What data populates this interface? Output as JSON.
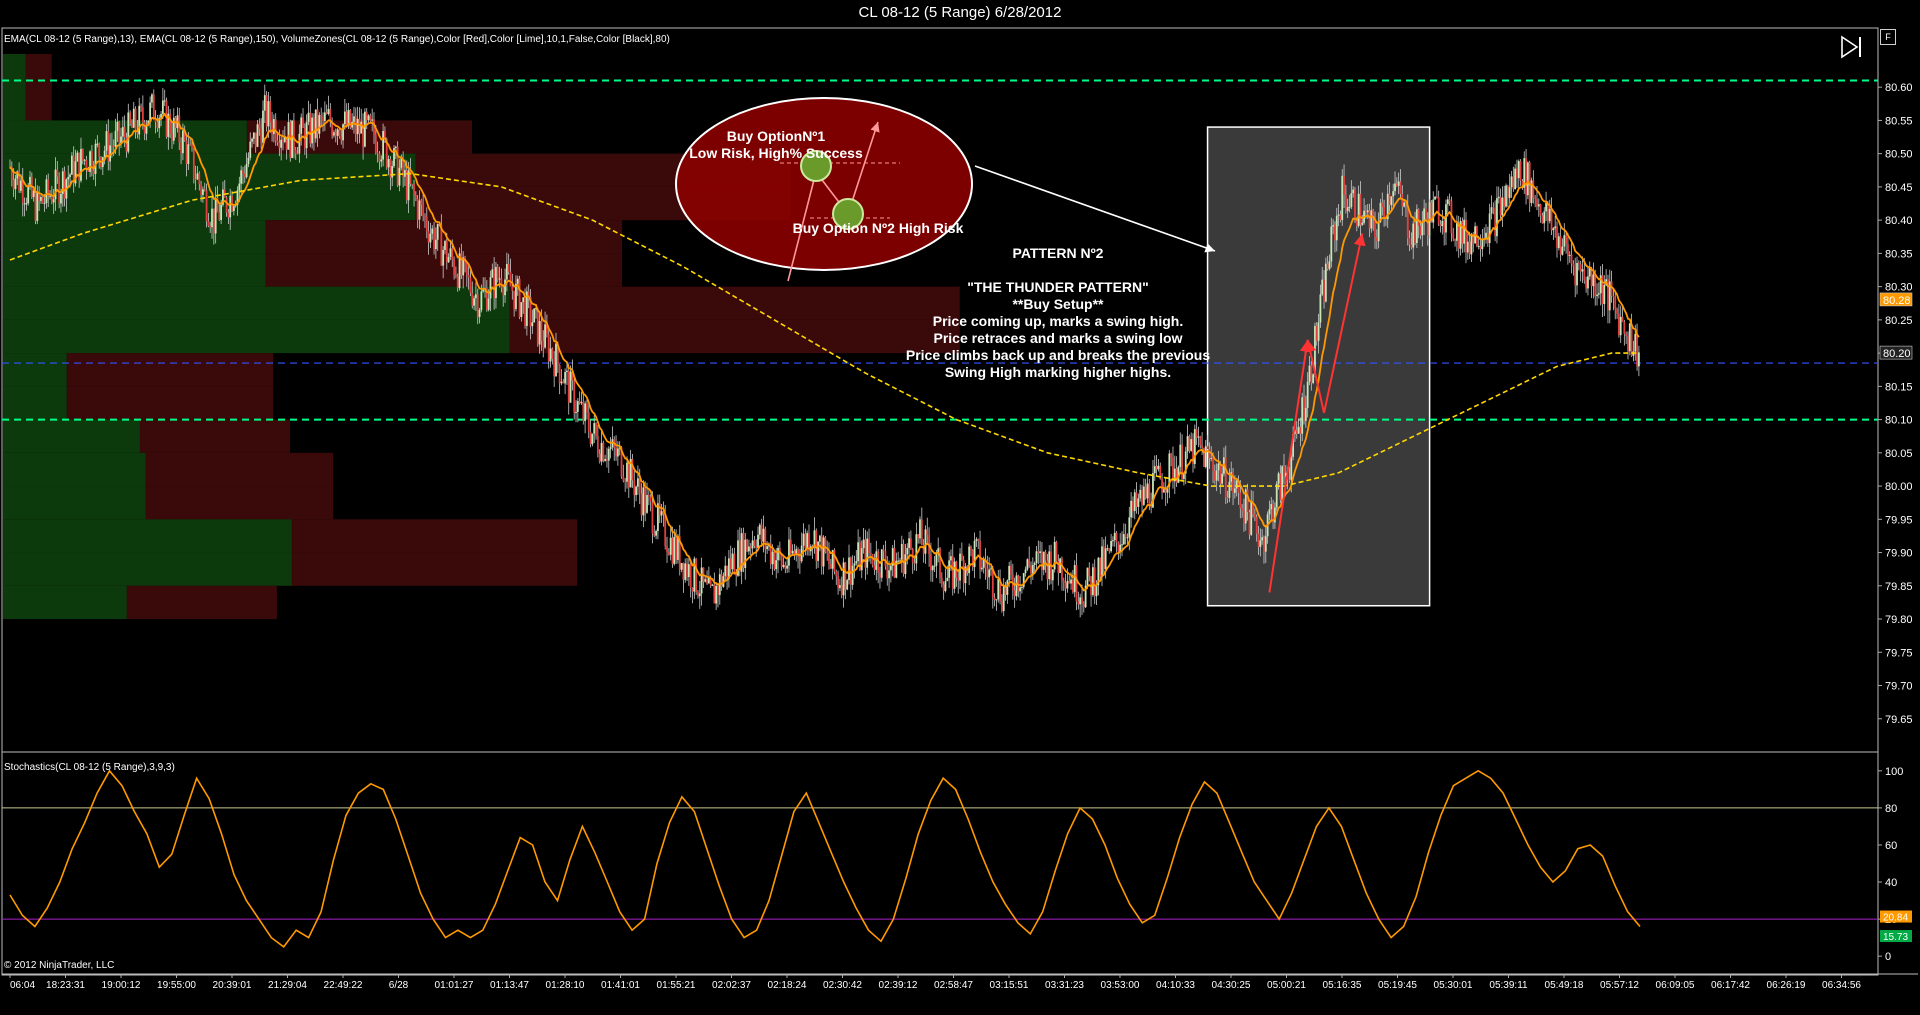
{
  "window": {
    "title": "CL 08-12 (5 Range)  6/28/2012"
  },
  "price_panel": {
    "indicator_label": "EMA(CL 08-12 (5 Range),13), EMA(CL 08-12 (5 Range),150), VolumeZones(CL 08-12 (5 Range),Color [Red],Color [Lime],10,1,False,Color [Black],80)"
  },
  "stoch_panel": {
    "indicator_label": "Stochastics(CL 08-12 (5 Range),3,9,3)"
  },
  "copyright": "© 2012 NinjaTrader, LLC",
  "annotations": {
    "buy_option_1_line1": "Buy OptionNº1",
    "buy_option_1_line2": "Low Risk, High% Success",
    "buy_option_2": "Buy Option Nº2 High Risk",
    "pattern_lines": [
      "PATTERN Nº2",
      "",
      "\"THE THUNDER PATTERN\"",
      "**Buy Setup**",
      "Price coming up, marks a swing high.",
      "Price retraces and marks a swing low",
      "Price climbs back up and breaks the previous",
      "Swing High marking higher highs."
    ]
  },
  "controls": {
    "play_icon": "skip-to-end-icon",
    "corner_label": "F"
  },
  "colors": {
    "background": "#000000",
    "bull_candle": "#c8e6b8",
    "bear_candle": "#e04040",
    "ema_fast": "#ff9900",
    "ema_slow": "#ffd700",
    "zone_buy": "#0d3a0d",
    "zone_sell": "#3a0a0a",
    "level_line": "#00ff88",
    "mid_line": "#3355ff",
    "stoch_line": "#ff9900",
    "stoch_80": "#c8c890",
    "stoch_20": "#aa22cc",
    "ellipse_fill": "#8b0000",
    "highlight_box": "#444444"
  },
  "chart_data": [
    {
      "type": "candlestick",
      "ylim": [
        79.6,
        80.68
      ],
      "y_ticks": [
        "80.60",
        "80.55",
        "80.50",
        "80.45",
        "80.40",
        "80.35",
        "80.30",
        "80.25",
        "80.20",
        "80.15",
        "80.10",
        "80.05",
        "80.00",
        "79.95",
        "79.90",
        "79.85",
        "79.80",
        "79.75",
        "79.70",
        "79.65"
      ],
      "x_ticks": [
        "06:04",
        "18:23:31",
        "19:00:12",
        "19:55:00",
        "20:39:01",
        "21:29:04",
        "22:49:22",
        "6/28",
        "01:01:27",
        "01:13:47",
        "01:28:10",
        "01:41:01",
        "01:55:21",
        "02:02:37",
        "02:18:24",
        "02:30:42",
        "02:39:12",
        "02:58:47",
        "03:15:51",
        "03:31:23",
        "03:53:00",
        "04:10:33",
        "04:30:25",
        "05:00:21",
        "05:16:35",
        "05:19:45",
        "05:30:01",
        "05:39:11",
        "05:49:18",
        "05:57:12",
        "06:09:05",
        "06:17:42",
        "06:26:19",
        "06:34:56"
      ],
      "horizontal_levels": [
        {
          "value": 80.61,
          "style": "dashed",
          "color": "#00ff88"
        },
        {
          "value": 80.185,
          "style": "dashed",
          "color": "#3355ff"
        },
        {
          "value": 80.1,
          "style": "dashed",
          "color": "#00ff88"
        }
      ],
      "price_badges": [
        {
          "value": 80.28,
          "label": "80.28",
          "color": "#ff9900"
        },
        {
          "value": 80.2,
          "label": "80.20",
          "color": "#222222"
        }
      ],
      "volume_zones": [
        {
          "lo": 80.55,
          "hi": 80.65,
          "buy": 0.012,
          "sell": 0.014
        },
        {
          "lo": 80.5,
          "hi": 80.55,
          "buy": 0.13,
          "sell": 0.12
        },
        {
          "lo": 80.45,
          "hi": 80.5,
          "buy": 0.22,
          "sell": 0.2
        },
        {
          "lo": 80.4,
          "hi": 80.45,
          "buy": 0.22,
          "sell": 0.2
        },
        {
          "lo": 80.35,
          "hi": 80.4,
          "buy": 0.14,
          "sell": 0.19
        },
        {
          "lo": 80.3,
          "hi": 80.35,
          "buy": 0.14,
          "sell": 0.19
        },
        {
          "lo": 80.25,
          "hi": 80.3,
          "buy": 0.27,
          "sell": 0.24
        },
        {
          "lo": 80.2,
          "hi": 80.25,
          "buy": 0.27,
          "sell": 0.24
        },
        {
          "lo": 80.15,
          "hi": 80.2,
          "buy": 0.034,
          "sell": 0.11
        },
        {
          "lo": 80.1,
          "hi": 80.15,
          "buy": 0.034,
          "sell": 0.11
        },
        {
          "lo": 80.05,
          "hi": 80.1,
          "buy": 0.073,
          "sell": 0.08
        },
        {
          "lo": 80.0,
          "hi": 80.05,
          "buy": 0.076,
          "sell": 0.1
        },
        {
          "lo": 79.95,
          "hi": 80.0,
          "buy": 0.076,
          "sell": 0.1
        },
        {
          "lo": 79.9,
          "hi": 79.95,
          "buy": 0.154,
          "sell": 0.152
        },
        {
          "lo": 79.85,
          "hi": 79.9,
          "buy": 0.154,
          "sell": 0.152
        },
        {
          "lo": 79.8,
          "hi": 79.85,
          "buy": 0.066,
          "sell": 0.08
        }
      ],
      "close_path": [
        [
          0,
          80.48
        ],
        [
          15,
          80.42
        ],
        [
          40,
          80.49
        ],
        [
          60,
          80.52
        ],
        [
          80,
          80.57
        ],
        [
          95,
          80.52
        ],
        [
          112,
          80.4
        ],
        [
          125,
          80.45
        ],
        [
          140,
          80.56
        ],
        [
          155,
          80.52
        ],
        [
          175,
          80.55
        ],
        [
          200,
          80.53
        ],
        [
          215,
          80.47
        ],
        [
          232,
          80.38
        ],
        [
          245,
          80.33
        ],
        [
          258,
          80.28
        ],
        [
          270,
          80.32
        ],
        [
          285,
          80.26
        ],
        [
          300,
          80.19
        ],
        [
          312,
          80.12
        ],
        [
          322,
          80.07
        ],
        [
          336,
          80.04
        ],
        [
          350,
          79.97
        ],
        [
          362,
          79.92
        ],
        [
          374,
          79.87
        ],
        [
          385,
          79.83
        ],
        [
          395,
          79.88
        ],
        [
          410,
          79.93
        ],
        [
          425,
          79.88
        ],
        [
          440,
          79.93
        ],
        [
          455,
          79.86
        ],
        [
          470,
          79.9
        ],
        [
          485,
          79.88
        ],
        [
          500,
          79.92
        ],
        [
          515,
          79.86
        ],
        [
          530,
          79.9
        ],
        [
          545,
          79.84
        ],
        [
          560,
          79.88
        ],
        [
          575,
          79.89
        ],
        [
          590,
          79.84
        ],
        [
          605,
          79.9
        ],
        [
          617,
          79.96
        ],
        [
          628,
          80.0
        ],
        [
          640,
          80.03
        ],
        [
          652,
          80.06
        ],
        [
          662,
          80.03
        ],
        [
          672,
          80.0
        ],
        [
          680,
          79.96
        ],
        [
          688,
          79.92
        ],
        [
          695,
          79.98
        ],
        [
          705,
          80.05
        ],
        [
          715,
          80.18
        ],
        [
          725,
          80.35
        ],
        [
          732,
          80.44
        ],
        [
          740,
          80.42
        ],
        [
          750,
          80.38
        ],
        [
          760,
          80.46
        ],
        [
          770,
          80.38
        ],
        [
          785,
          80.42
        ],
        [
          800,
          80.37
        ],
        [
          815,
          80.4
        ],
        [
          830,
          80.48
        ],
        [
          845,
          80.4
        ],
        [
          860,
          80.33
        ],
        [
          875,
          80.3
        ],
        [
          885,
          80.25
        ],
        [
          895,
          80.2
        ]
      ],
      "ema_slow_path": [
        [
          0,
          80.34
        ],
        [
          40,
          80.38
        ],
        [
          100,
          80.43
        ],
        [
          160,
          80.46
        ],
        [
          220,
          80.47
        ],
        [
          270,
          80.45
        ],
        [
          320,
          80.4
        ],
        [
          370,
          80.33
        ],
        [
          420,
          80.25
        ],
        [
          470,
          80.17
        ],
        [
          520,
          80.1
        ],
        [
          570,
          80.05
        ],
        [
          620,
          80.02
        ],
        [
          660,
          80.0
        ],
        [
          700,
          80.0
        ],
        [
          730,
          80.02
        ],
        [
          760,
          80.06
        ],
        [
          790,
          80.1
        ],
        [
          820,
          80.14
        ],
        [
          850,
          80.18
        ],
        [
          880,
          80.2
        ],
        [
          895,
          80.2
        ]
      ],
      "highlight_box": {
        "x0": 658,
        "x1": 780,
        "y_top": 80.54,
        "y_bottom": 79.82
      },
      "red_arrows": [
        {
          "from": [
            692,
            79.84
          ],
          "to": [
            713,
            80.22
          ]
        },
        {
          "from": [
            722,
            80.11
          ],
          "to": [
            713,
            80.22
          ]
        },
        {
          "from": [
            722,
            80.11
          ],
          "to": [
            743,
            80.38
          ]
        }
      ]
    },
    {
      "type": "line",
      "ylim": [
        -8,
        108
      ],
      "y_ticks": [
        "100",
        "80",
        "60",
        "40",
        "20",
        "0"
      ],
      "reference_levels": [
        80,
        20
      ],
      "value_badges": [
        {
          "value": 20.84,
          "label": "20.84",
          "color": "#ff9900"
        },
        {
          "value": 15.73,
          "label": "15.73",
          "color": "#00aa44"
        }
      ],
      "values": [
        33,
        22,
        16,
        26,
        40,
        58,
        72,
        88,
        100,
        92,
        78,
        66,
        48,
        55,
        76,
        96,
        85,
        66,
        44,
        30,
        20,
        10,
        5,
        14,
        10,
        24,
        52,
        76,
        88,
        93,
        90,
        74,
        54,
        34,
        20,
        10,
        14,
        10,
        14,
        28,
        46,
        64,
        60,
        40,
        30,
        52,
        70,
        56,
        40,
        24,
        14,
        20,
        50,
        72,
        86,
        78,
        58,
        38,
        20,
        10,
        14,
        30,
        54,
        78,
        88,
        72,
        56,
        40,
        26,
        14,
        8,
        20,
        42,
        66,
        84,
        96,
        90,
        74,
        56,
        40,
        28,
        18,
        12,
        24,
        46,
        66,
        80,
        74,
        60,
        42,
        28,
        18,
        22,
        42,
        64,
        82,
        94,
        88,
        72,
        56,
        40,
        30,
        20,
        34,
        52,
        70,
        80,
        70,
        52,
        34,
        20,
        10,
        16,
        32,
        56,
        76,
        92,
        96,
        100,
        96,
        88,
        74,
        60,
        48,
        40,
        46,
        58,
        60,
        54,
        38,
        24,
        16
      ]
    }
  ]
}
